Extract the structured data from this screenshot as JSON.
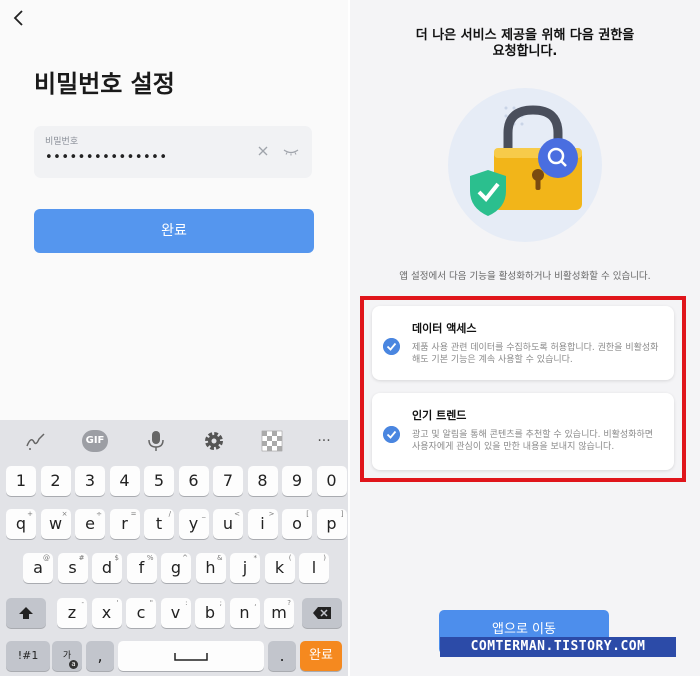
{
  "left": {
    "title": "비밀번호 설정",
    "password": {
      "label": "비밀번호",
      "value": "•••••••••••••••"
    },
    "done_label": "완료"
  },
  "keyboard": {
    "toolbar": [
      "handwriting-icon",
      "gif-icon",
      "microphone-icon",
      "gear-icon",
      "clipboard-icon",
      "more-icon"
    ],
    "gif_label": "GIF",
    "more_label": "···",
    "numbers": [
      "1",
      "2",
      "3",
      "4",
      "5",
      "6",
      "7",
      "8",
      "9",
      "0"
    ],
    "row1": [
      {
        "k": "q",
        "h": "+"
      },
      {
        "k": "w",
        "h": "×"
      },
      {
        "k": "e",
        "h": "÷"
      },
      {
        "k": "r",
        "h": "="
      },
      {
        "k": "t",
        "h": "/"
      },
      {
        "k": "y",
        "h": "_"
      },
      {
        "k": "u",
        "h": "<"
      },
      {
        "k": "i",
        "h": ">"
      },
      {
        "k": "o",
        "h": "["
      },
      {
        "k": "p",
        "h": "]"
      }
    ],
    "row2": [
      {
        "k": "a",
        "h": "@"
      },
      {
        "k": "s",
        "h": "#"
      },
      {
        "k": "d",
        "h": "$"
      },
      {
        "k": "f",
        "h": "%"
      },
      {
        "k": "g",
        "h": "^"
      },
      {
        "k": "h",
        "h": "&"
      },
      {
        "k": "j",
        "h": "*"
      },
      {
        "k": "k",
        "h": "("
      },
      {
        "k": "l",
        "h": ")"
      }
    ],
    "row3": [
      {
        "k": "z",
        "h": "-"
      },
      {
        "k": "x",
        "h": "'"
      },
      {
        "k": "c",
        "h": "\""
      },
      {
        "k": "v",
        "h": ":"
      },
      {
        "k": "b",
        "h": ";"
      },
      {
        "k": "n",
        "h": ","
      },
      {
        "k": "m",
        "h": "?"
      }
    ],
    "sym_label": "!#1",
    "lang_label": "가",
    "lang_hint": "a",
    "comma": ",",
    "period": ".",
    "enter_label": "완료"
  },
  "right": {
    "title_line1": "더 나은 서비스 제공을 위해 다음 권한을",
    "title_line2": "요청합니다.",
    "description": "앱 설정에서 다음 기능을 활성화하거나 비활성화할 수 있습니다.",
    "permissions": [
      {
        "title": "데이터 액세스",
        "text": "제품 사용 관련 데이터를 수집하도록 허용합니다. 권한을 비활성화해도 기본 기능은 계속 사용할 수 있습니다.",
        "checked": true
      },
      {
        "title": "인기 트렌드",
        "text": "광고 및 알림을 통해 콘텐츠를 추천할 수 있습니다. 비활성화하면 사용자에게 관심이 있을 만한 내용을 보내지 않습니다.",
        "checked": true
      }
    ],
    "go_button": "앱으로 이동",
    "watermark": "COMTERMAN.TISTORY.COM",
    "colors": {
      "accent": "#4d8eec",
      "highlight": "#e0151b",
      "lock": "#f2b519"
    }
  }
}
